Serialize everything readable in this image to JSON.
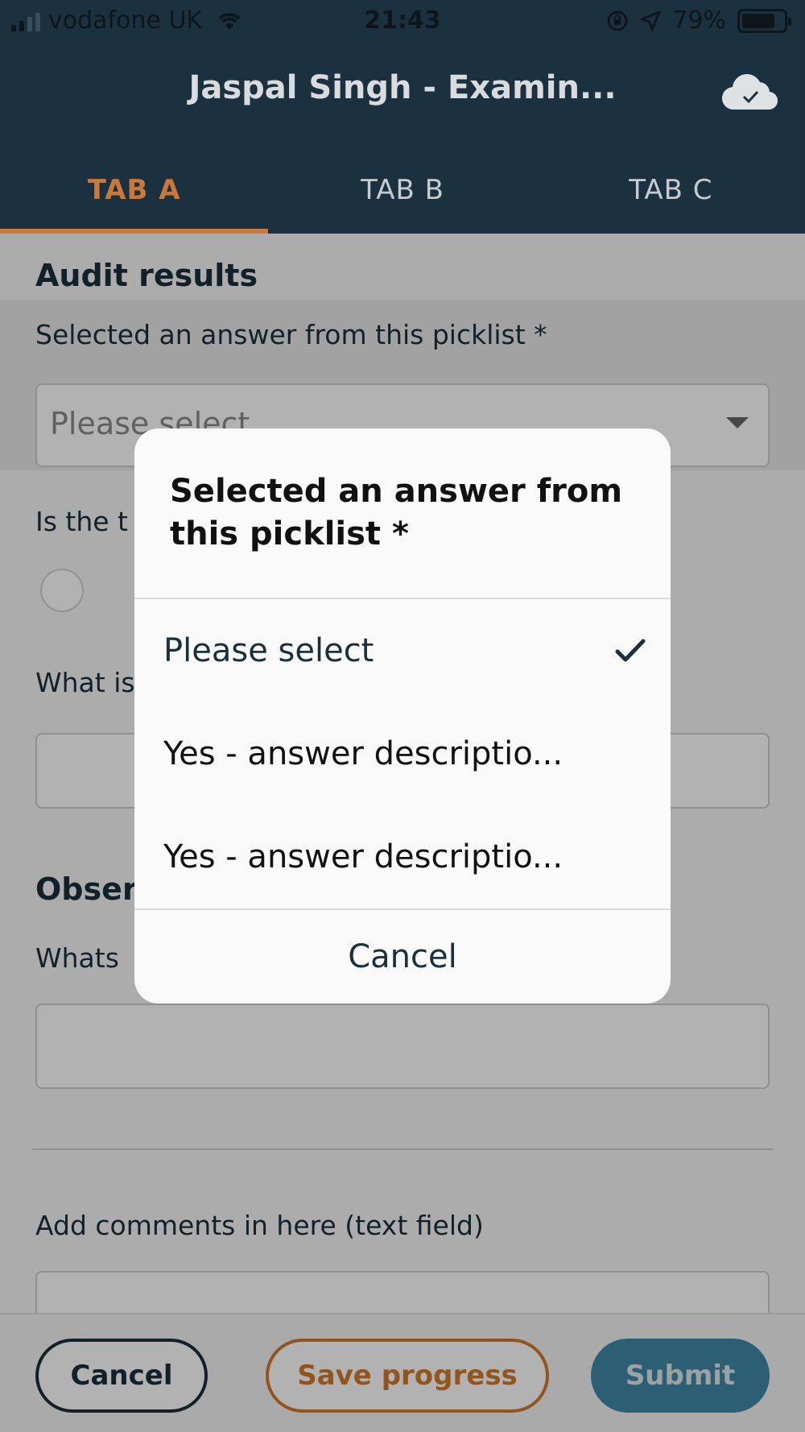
{
  "status_bar": {
    "carrier": "vodafone UK",
    "time": "21:43",
    "battery": "79%",
    "battery_level": 0.79
  },
  "header": {
    "title": "Jaspal Singh - Examin...",
    "sync_icon": "cloud-check-icon",
    "tabs": [
      {
        "label": "TAB A",
        "active": true
      },
      {
        "label": "TAB B",
        "active": false
      },
      {
        "label": "TAB C",
        "active": false
      }
    ]
  },
  "form": {
    "audit_title": "Audit results",
    "picklist_label": "Selected an answer from this picklist *",
    "picklist_value": "Please select",
    "question2_label_partial": "Is the t",
    "question3_label_partial": "What is",
    "observations_title_partial": "Obser",
    "question4_label_partial": "Whats",
    "comments_label": "Add comments in here (text field)"
  },
  "footer": {
    "cancel_label": "Cancel",
    "save_label": "Save progress",
    "submit_label": "Submit"
  },
  "picker": {
    "title": "Selected an answer from this picklist *",
    "options": [
      {
        "label": "Please select",
        "selected": true
      },
      {
        "label": "Yes - answer descriptio...",
        "selected": false
      },
      {
        "label": "Yes - answer descriptio...",
        "selected": false
      }
    ],
    "cancel_label": "Cancel"
  },
  "colors": {
    "header_bg": "#1c3140",
    "accent_orange": "#c8793b",
    "submit_blue": "#3f88a6",
    "text_dark": "#1b2f3c"
  }
}
